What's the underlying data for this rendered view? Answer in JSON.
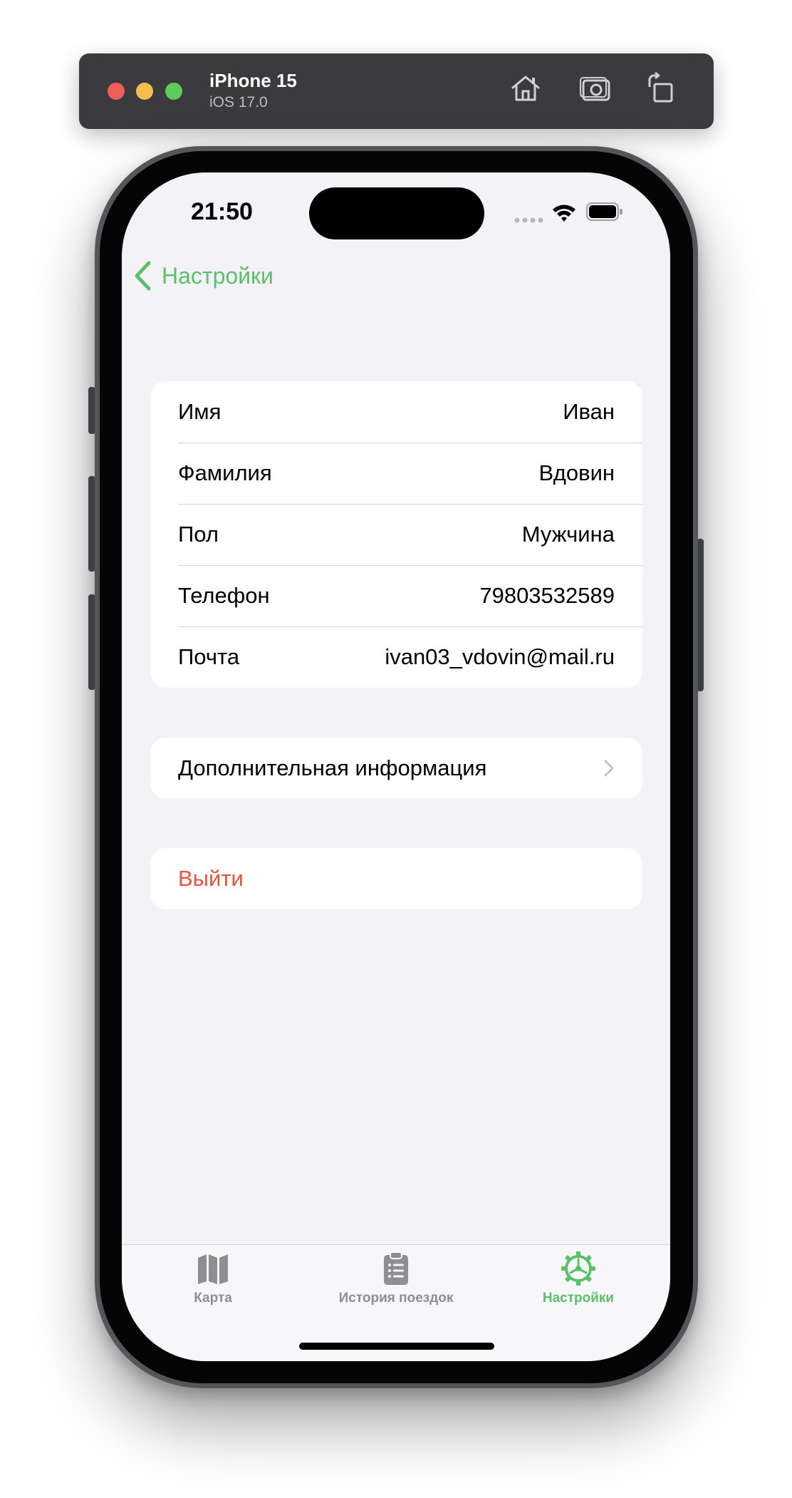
{
  "simulator": {
    "device_name": "iPhone 15",
    "os_version": "iOS 17.0",
    "icons": [
      "home-icon",
      "screenshot-icon",
      "rotate-icon"
    ]
  },
  "status_bar": {
    "time": "21:50",
    "icons": [
      "signal-icon",
      "wifi-icon",
      "battery-icon"
    ]
  },
  "nav": {
    "back_label": "Настройки"
  },
  "profile": {
    "rows": [
      {
        "label": "Имя",
        "value": "Иван"
      },
      {
        "label": "Фамилия",
        "value": "Вдовин"
      },
      {
        "label": "Пол",
        "value": "Мужчина"
      },
      {
        "label": "Телефон",
        "value": "79803532589"
      },
      {
        "label": "Почта",
        "value": "ivan03_vdovin@mail.ru"
      }
    ]
  },
  "extra_info": {
    "label": "Дополнительная информация"
  },
  "logout": {
    "label": "Выйти"
  },
  "tabbar": {
    "tabs": [
      {
        "label": "Карта",
        "icon": "map-icon",
        "active": false
      },
      {
        "label": "История поездок",
        "icon": "clipboard-icon",
        "active": false
      },
      {
        "label": "Настройки",
        "icon": "gear-icon",
        "active": true
      }
    ]
  },
  "colors": {
    "accent": "#5cbf6a",
    "destructive": "#e5533f",
    "background": "#f2f2f7"
  }
}
